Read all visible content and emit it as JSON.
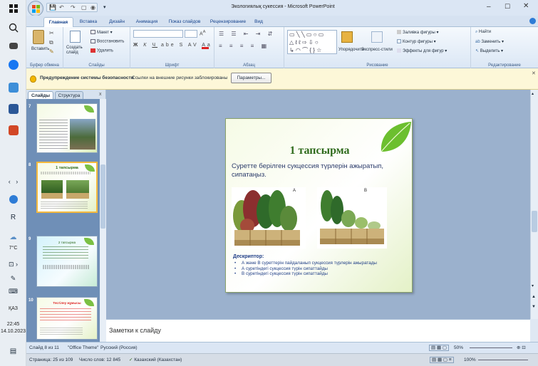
{
  "taskbar": {
    "weather_temp": "7°C",
    "language": "ҚАЗ",
    "time": "22:45",
    "date": "14.10.2023"
  },
  "window": {
    "title": "Экологиялық сукессия - Microsoft PowerPoint"
  },
  "ribbon": {
    "tabs": [
      "Главная",
      "Вставка",
      "Дизайн",
      "Анимация",
      "Показ слайдов",
      "Рецензирование",
      "Вид"
    ],
    "groups": {
      "clipboard": {
        "label": "Буфер обмена",
        "paste": "Вставить"
      },
      "slides": {
        "label": "Слайды",
        "new_slide": "Создать слайд",
        "layout": "Макет",
        "reset": "Восстановить",
        "delete": "Удалить"
      },
      "font": {
        "label": "Шрифт"
      },
      "paragraph": {
        "label": "Абзац"
      },
      "drawing": {
        "label": "Рисование",
        "arrange": "Упорядочить",
        "quick_styles": "Экспресс-стили",
        "fill": "Заливка фигуры",
        "outline": "Контур фигуры",
        "effects": "Эффекты для фигур"
      },
      "editing": {
        "label": "Редактирование",
        "find": "Найти",
        "replace": "Заменить",
        "select": "Выделить"
      }
    }
  },
  "security": {
    "title": "Предупреждение системы безопасности",
    "message": "Ссылки на внешние рисунки заблокированы",
    "button": "Параметры..."
  },
  "left_panel": {
    "tab_slides": "Слайды",
    "tab_outline": "Структура",
    "close": "x",
    "slides": [
      {
        "number": "7"
      },
      {
        "number": "8",
        "title": "1 тапсырма"
      },
      {
        "number": "9",
        "title": "2 тапсырма"
      },
      {
        "number": "10",
        "title": "Тестілеу жұмысы"
      }
    ]
  },
  "slide": {
    "title": "1 тапсырма",
    "question": "Суретте берілген сукцессия түрлерін ажыратып, сипатаңыз.",
    "label_a": "A",
    "label_b": "B",
    "descriptor_title": "Дескриптор:",
    "descriptors": [
      "А және В суреттерін пайдаланып сукцессия түрлерін ажыратады",
      "А суретіндегі сукцессия түрін сипаттайды",
      "В суретіндегі сукцессия түрін сипаттайды"
    ]
  },
  "notes": {
    "placeholder": "Заметки к слайду"
  },
  "status": {
    "slide_counter": "Слайд 8 из 11",
    "theme": "\"Office Theme\"",
    "language": "Русский (Россия)",
    "zoom": "50%"
  },
  "word_status": {
    "page": "Страница: 25 из 109",
    "words": "Число слов: 12 845",
    "language": "Казахский (Казахстан)",
    "zoom": "100%"
  },
  "colors": {
    "accent_green": "#5aa02c",
    "slide_title": "#2f6b1c",
    "selection_orange": "#f5b93d"
  }
}
